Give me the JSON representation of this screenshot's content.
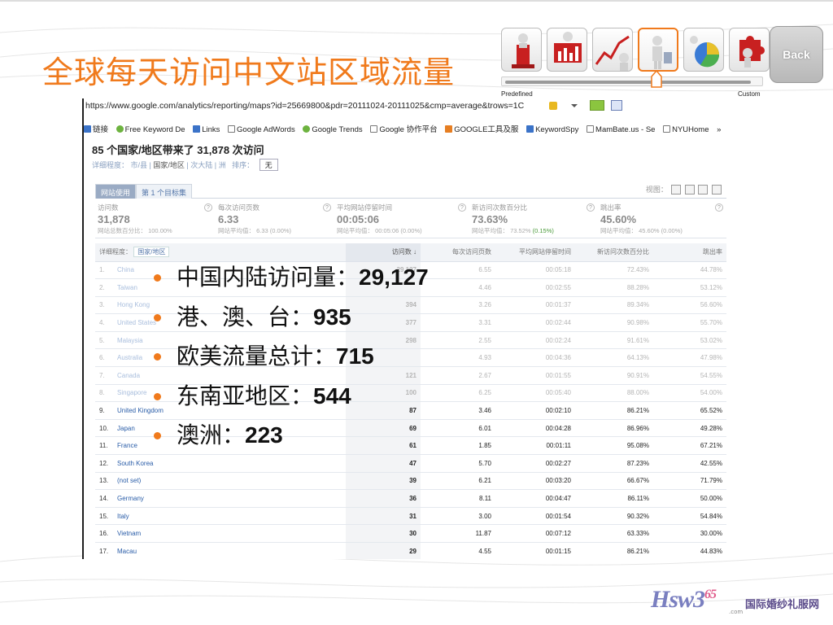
{
  "slide": {
    "title": "全球每天访问中文站区域流量"
  },
  "nav": {
    "icons": [
      "podium-figure-icon",
      "bar-chart-figure-icon",
      "line-chart-figure-icon",
      "person-presenting-icon",
      "pie-chart-figure-icon",
      "puzzle-figure-icon"
    ],
    "predefined_label": "Predefined",
    "custom_label": "Custom",
    "back_label": "Back"
  },
  "browser": {
    "url": "https://www.google.com/analytics/reporting/maps?id=25669800&pdr=20111024-20111025&cmp=average&trows=1C",
    "bookmarks": [
      "链接",
      "Free Keyword De",
      "Links",
      "Google AdWords",
      "Google Trends",
      "Google 协作平台",
      "GOOGLE工具及服",
      "KeywordSpy",
      "MamBate.us - Se",
      "NYUHome",
      "»"
    ]
  },
  "report": {
    "heading": "85 个国家/地区带来了  31,878 次访问",
    "detail_label": "详细程度：",
    "detail_options": [
      "市/县",
      "国家/地区",
      "次大陆",
      "洲"
    ],
    "sort_label": "排序：",
    "sort_value": "无",
    "tabs": [
      "网站使用",
      "第 1 个目标集"
    ],
    "view_label": "视图：",
    "metrics": [
      {
        "label": "访问数",
        "value": "31,878",
        "sub": "网站总数百分比：",
        "sub_value": "100.00%",
        "sub_extra": ""
      },
      {
        "label": "每次访问页数",
        "value": "6.33",
        "sub": "网站平均值：",
        "sub_value": "6.33 (0.00%)",
        "sub_extra": ""
      },
      {
        "label": "平均网站停留时间",
        "value": "00:05:06",
        "sub": "网站平均值：",
        "sub_value": "00:05:06 (0.00%)",
        "sub_extra": ""
      },
      {
        "label": "新访问次数百分比",
        "value": "73.63%",
        "sub": "网站平均值：",
        "sub_value": "73.52%",
        "sub_extra": "(0.15%)"
      },
      {
        "label": "跳出率",
        "value": "45.60%",
        "sub": "网站平均值：",
        "sub_value": "45.60% (0.00%)",
        "sub_extra": ""
      }
    ],
    "table": {
      "detail_label": "详细程度：",
      "detail_value": "国家/地区",
      "columns": [
        "访问数 ↓",
        "每次访问页数",
        "平均网站停留时间",
        "新访问次数百分比",
        "跳出率"
      ],
      "rows": [
        {
          "idx": "1.",
          "country": "China",
          "visits": "29,127",
          "pages": "6.55",
          "time": "00:05:18",
          "new": "72.43%",
          "bounce": "44.78%"
        },
        {
          "idx": "2.",
          "country": "Taiwan",
          "visits": "",
          "pages": "4.46",
          "time": "00:02:55",
          "new": "88.28%",
          "bounce": "53.12%"
        },
        {
          "idx": "3.",
          "country": "Hong Kong",
          "visits": "394",
          "pages": "3.26",
          "time": "00:01:37",
          "new": "89.34%",
          "bounce": "56.60%"
        },
        {
          "idx": "4.",
          "country": "United States",
          "visits": "377",
          "pages": "3.31",
          "time": "00:02:44",
          "new": "90.98%",
          "bounce": "55.70%"
        },
        {
          "idx": "5.",
          "country": "Malaysia",
          "visits": "298",
          "pages": "2.55",
          "time": "00:02:24",
          "new": "91.61%",
          "bounce": "53.02%"
        },
        {
          "idx": "6.",
          "country": "Australia",
          "visits": "",
          "pages": "4.93",
          "time": "00:04:36",
          "new": "64.13%",
          "bounce": "47.98%"
        },
        {
          "idx": "7.",
          "country": "Canada",
          "visits": "121",
          "pages": "2.67",
          "time": "00:01:55",
          "new": "90.91%",
          "bounce": "54.55%"
        },
        {
          "idx": "8.",
          "country": "Singapore",
          "visits": "100",
          "pages": "6.25",
          "time": "00:05:40",
          "new": "88.00%",
          "bounce": "54.00%"
        },
        {
          "idx": "9.",
          "country": "United Kingdom",
          "visits": "87",
          "pages": "3.46",
          "time": "00:02:10",
          "new": "86.21%",
          "bounce": "65.52%"
        },
        {
          "idx": "10.",
          "country": "Japan",
          "visits": "69",
          "pages": "6.01",
          "time": "00:04:28",
          "new": "86.96%",
          "bounce": "49.28%"
        },
        {
          "idx": "11.",
          "country": "France",
          "visits": "61",
          "pages": "1.85",
          "time": "00:01:11",
          "new": "95.08%",
          "bounce": "67.21%"
        },
        {
          "idx": "12.",
          "country": "South Korea",
          "visits": "47",
          "pages": "5.70",
          "time": "00:02:27",
          "new": "87.23%",
          "bounce": "42.55%"
        },
        {
          "idx": "13.",
          "country": "(not set)",
          "visits": "39",
          "pages": "6.21",
          "time": "00:03:20",
          "new": "66.67%",
          "bounce": "71.79%"
        },
        {
          "idx": "14.",
          "country": "Germany",
          "visits": "36",
          "pages": "8.11",
          "time": "00:04:47",
          "new": "86.11%",
          "bounce": "50.00%"
        },
        {
          "idx": "15.",
          "country": "Italy",
          "visits": "31",
          "pages": "3.00",
          "time": "00:01:54",
          "new": "90.32%",
          "bounce": "54.84%"
        },
        {
          "idx": "16.",
          "country": "Vietnam",
          "visits": "30",
          "pages": "11.87",
          "time": "00:07:12",
          "new": "63.33%",
          "bounce": "30.00%"
        },
        {
          "idx": "17.",
          "country": "Macau",
          "visits": "29",
          "pages": "4.55",
          "time": "00:01:15",
          "new": "86.21%",
          "bounce": "44.83%"
        }
      ]
    }
  },
  "bullets": [
    {
      "label": "中国内陆访问量：",
      "value": "29,127"
    },
    {
      "label": "港、澳、台：",
      "value": "935"
    },
    {
      "label": "欧美流量总计：",
      "value": "715"
    },
    {
      "label": "东南亚地区：",
      "value": "544"
    },
    {
      "label": "澳洲：",
      "value": "223"
    }
  ],
  "logo": {
    "brand": "Hsw3",
    "brand_sup": "65",
    "com": ".com",
    "cn": "国际婚纱礼服网"
  },
  "colors": {
    "accent": "#f07a1c",
    "link": "#2a5da8"
  }
}
